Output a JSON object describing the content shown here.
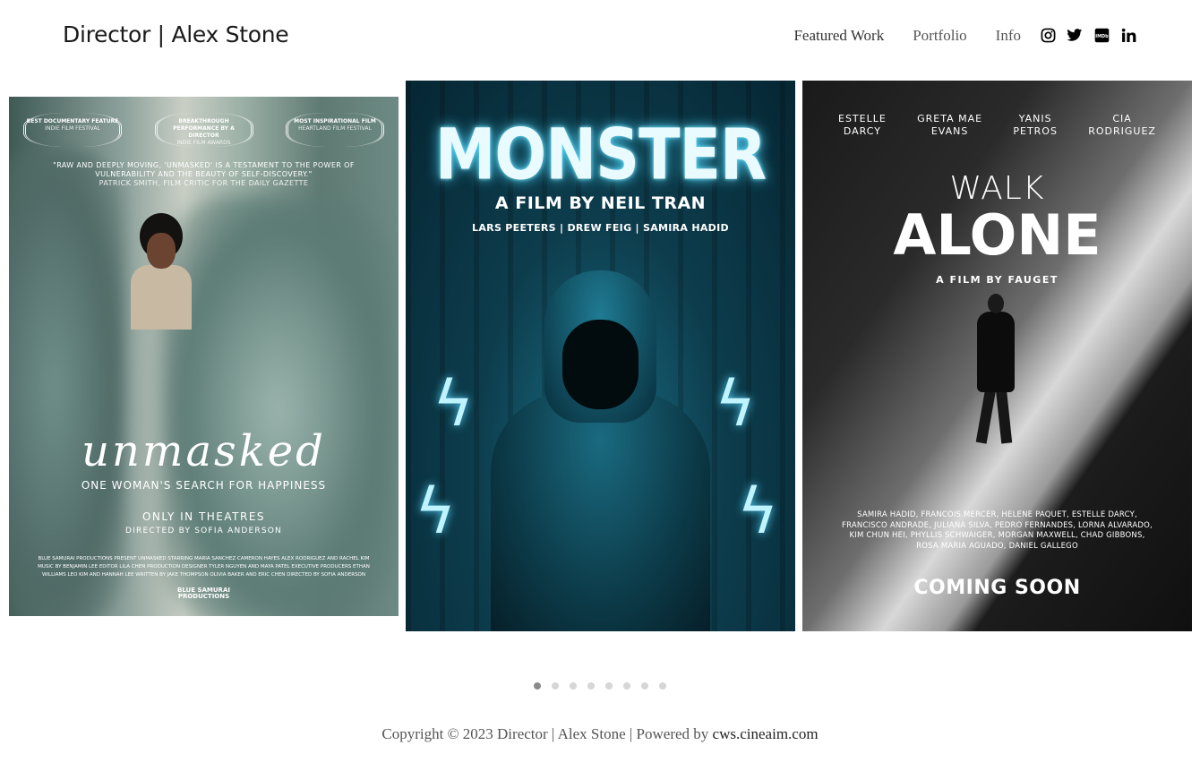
{
  "header": {
    "title": "Director | Alex Stone",
    "nav": [
      {
        "label": "Featured Work"
      },
      {
        "label": "Portfolio"
      },
      {
        "label": "Info"
      }
    ],
    "social_icons": [
      "instagram-icon",
      "twitter-icon",
      "imdb-icon",
      "linkedin-icon"
    ]
  },
  "posters": [
    {
      "laurels": [
        {
          "title": "BEST DOCUMENTARY FEATURE",
          "festival": "INDIE FILM FESTIVAL"
        },
        {
          "title": "BREAKTHROUGH PERFORMANCE BY A DIRECTOR",
          "festival": "INDIE FILM AWARDS"
        },
        {
          "title": "MOST INSPIRATIONAL FILM",
          "festival": "HEARTLAND FILM FESTIVAL"
        }
      ],
      "quote": "\"RAW AND DEEPLY MOVING, 'UNMASKED' IS A TESTAMENT TO THE POWER OF VULNERABILITY AND THE BEAUTY OF SELF-DISCOVERY.\"",
      "quote_by": "PATRICK SMITH, FILM CRITIC FOR THE DAILY GAZETTE",
      "title": "unmasked",
      "tagline": "ONE WOMAN'S SEARCH FOR HAPPINESS",
      "release": "ONLY IN THEATRES",
      "director": "DIRECTED BY SOFIA ANDERSON",
      "credits": "BLUE SAMURAI PRODUCTIONS PRESENT UNMASKED STARRING MARIA SANCHEZ CAMERON HAYES ALEX RODRIGUEZ AND RACHEL KIM MUSIC BY BENJAMIN LEE EDITOR LILA CHEN PRODUCTION DESIGNER TYLER NGUYEN AND MAYA PATEL EXECUTIVE PRODUCERS ETHAN WILLIAMS LEO KIM AND HANNAH LEE WRITTEN BY JAKE THOMPSON OLIVIA BAKER AND ERIC CHEN DIRECTED BY SOFIA ANDERSON",
      "logo_line1": "BLUE SAMURAI",
      "logo_line2": "PRODUCTIONS"
    },
    {
      "title": "MONSTER",
      "subtitle": "A FILM BY NEIL TRAN",
      "cast": "LARS PEETERS  |  DREW FEIG  |  SAMIRA HADID"
    },
    {
      "cast": [
        {
          "line1": "ESTELLE",
          "line2": "DARCY"
        },
        {
          "line1": "GRETA MAE",
          "line2": "EVANS"
        },
        {
          "line1": "YANIS",
          "line2": "PETROS"
        },
        {
          "line1": "CIA",
          "line2": "RODRIGUEZ"
        }
      ],
      "title_top": "WALK",
      "title_bottom": "ALONE",
      "byline": "A FILM BY FAUGET",
      "credits": "SAMIRA HADID, FRANCOIS MERCER, HELENE PAQUET, ESTELLE DARCY, FRANCISCO ANDRADE, JULIANA SILVA, PEDRO FERNANDES, LORNA ALVARADO, KIM CHUN HEI, PHYLLIS SCHWAIGER, MORGAN MAXWELL, CHAD GIBBONS, ROSA MARIA AGUADO, DANIEL GALLEGO",
      "release": "COMING SOON"
    }
  ],
  "carousel": {
    "total_slides": 8,
    "active_slide": 1
  },
  "footer": {
    "text": "Copyright © 2023 Director | Alex Stone | Powered by ",
    "link": "cws.cineaim.com"
  }
}
